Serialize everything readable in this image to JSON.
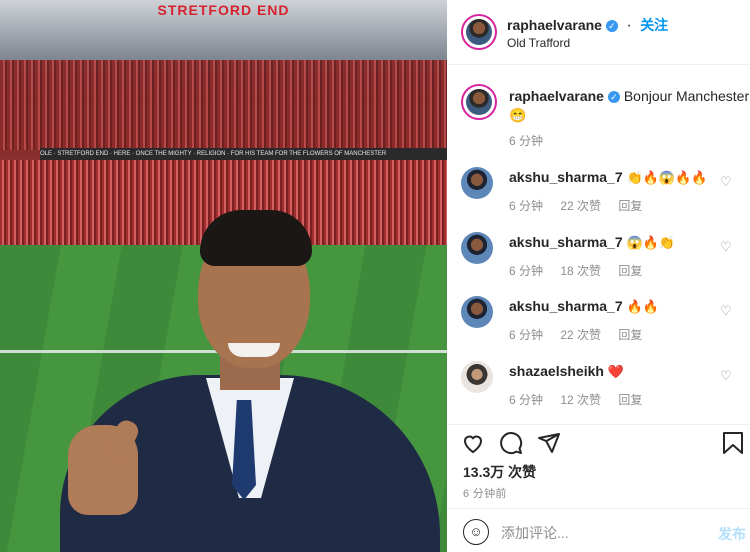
{
  "photo": {
    "stand_text": "STRETFORD END",
    "banner_text": "OLE · STRETFORD END · HERE · ONCE THE MIGHTY · RELIGION · FOR HIS TEAM FOR THE FLOWERS OF MANCHESTER"
  },
  "header": {
    "username": "raphaelvarane",
    "verified_icon": "verified-badge-icon",
    "separator": "·",
    "follow_label": "关注",
    "location": "Old Trafford"
  },
  "caption": {
    "username": "raphaelvarane",
    "text": "Bonjour Manchester!",
    "emoji": "😁",
    "time": "6 分钟"
  },
  "comments": [
    {
      "username": "akshu_sharma_7",
      "text": "👏🔥😱🔥🔥",
      "time": "6 分钟",
      "likes": "22 次赞",
      "reply": "回复"
    },
    {
      "username": "akshu_sharma_7",
      "text": "😱🔥👏",
      "time": "6 分钟",
      "likes": "18 次赞",
      "reply": "回复"
    },
    {
      "username": "akshu_sharma_7",
      "text": "🔥🔥",
      "time": "6 分钟",
      "likes": "22 次赞",
      "reply": "回复"
    },
    {
      "username": "shazaelsheikh",
      "text": "❤️",
      "time": "6 分钟",
      "likes": "12 次赞",
      "reply": "回复"
    }
  ],
  "actions": {
    "like_icon": "heart-icon",
    "comment_icon": "comment-icon",
    "share_icon": "send-icon",
    "save_icon": "bookmark-icon"
  },
  "likes_text": "13.3万 次赞",
  "post_time": "6 分钟前",
  "add_comment": {
    "emoji_icon": "emoji-icon",
    "placeholder": "添加评论...",
    "post_label": "发布"
  },
  "colors": {
    "accent": "#0095f6",
    "verified": "#3897f0",
    "post_disabled": "#b2dffc",
    "muted": "#8e8e8e"
  }
}
